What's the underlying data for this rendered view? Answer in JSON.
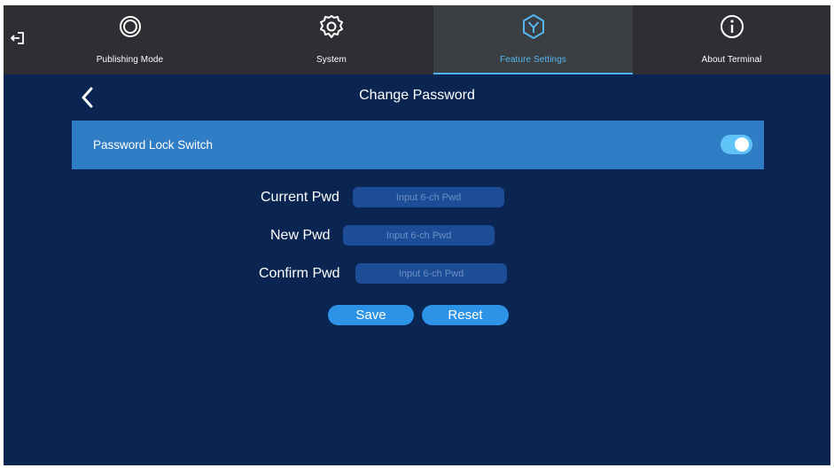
{
  "nav": {
    "tabs": [
      {
        "label": "Publishing Mode",
        "icon": "publishing-mode-icon"
      },
      {
        "label": "System",
        "icon": "gear-icon"
      },
      {
        "label": "Feature Settings",
        "icon": "feature-settings-icon",
        "active": true
      },
      {
        "label": "About Terminal",
        "icon": "info-icon"
      }
    ],
    "exit_icon": "exit-icon"
  },
  "page": {
    "title": "Change Password",
    "back_icon": "chevron-left-icon"
  },
  "lock": {
    "label": "Password Lock Switch",
    "enabled": true
  },
  "form": {
    "current": {
      "label": "Current Pwd",
      "placeholder": "Input 6-ch Pwd",
      "value": ""
    },
    "new": {
      "label": "New Pwd",
      "placeholder": "Input 6-ch Pwd",
      "value": ""
    },
    "confirm": {
      "label": "Confirm Pwd",
      "placeholder": "Input 6-ch Pwd",
      "value": ""
    }
  },
  "buttons": {
    "save": "Save",
    "reset": "Reset"
  },
  "colors": {
    "background": "#0b2552",
    "topbar": "#2d2f33",
    "accent": "#4fb3ef",
    "lock_row": "#2f7dc4",
    "input": "#1d4d97",
    "button": "#2d93e6"
  }
}
